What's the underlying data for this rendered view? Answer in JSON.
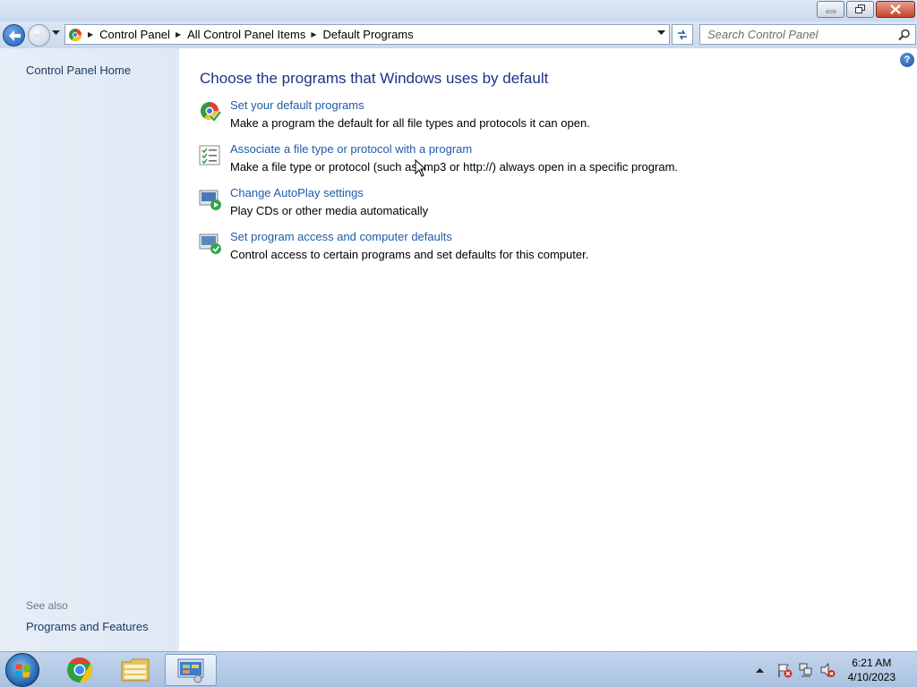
{
  "window": {
    "buttons": {
      "minimize": "minimize",
      "restore": "restore",
      "close": "close"
    }
  },
  "navigation": {
    "breadcrumbs": [
      "Control Panel",
      "All Control Panel Items",
      "Default Programs"
    ],
    "search_placeholder": "Search Control Panel"
  },
  "sidebar": {
    "home_label": "Control Panel Home",
    "see_also_label": "See also",
    "see_also_items": [
      "Programs and Features"
    ]
  },
  "main": {
    "title": "Choose the programs that Windows uses by default",
    "tasks": [
      {
        "link": "Set your default programs",
        "description": "Make a program the default for all file types and protocols it can open.",
        "icon": "default-programs-icon"
      },
      {
        "link": "Associate a file type or protocol with a program",
        "description": "Make a file type or protocol (such as .mp3 or http://) always open in a specific program.",
        "icon": "file-association-icon"
      },
      {
        "link": "Change AutoPlay settings",
        "description": "Play CDs or other media automatically",
        "icon": "autoplay-icon"
      },
      {
        "link": "Set program access and computer defaults",
        "description": "Control access to certain programs and set defaults for this computer.",
        "icon": "program-access-icon"
      }
    ]
  },
  "taskbar": {
    "items": [
      "start-orb",
      "chrome",
      "windows-explorer",
      "control-panel"
    ],
    "active_item": "control-panel",
    "clock_time": "6:21 AM",
    "clock_date": "4/10/2023"
  },
  "colors": {
    "title_blue": "#1e3287",
    "link_blue": "#1f5ca8",
    "sidebar_bg": "#e3ebf6"
  }
}
